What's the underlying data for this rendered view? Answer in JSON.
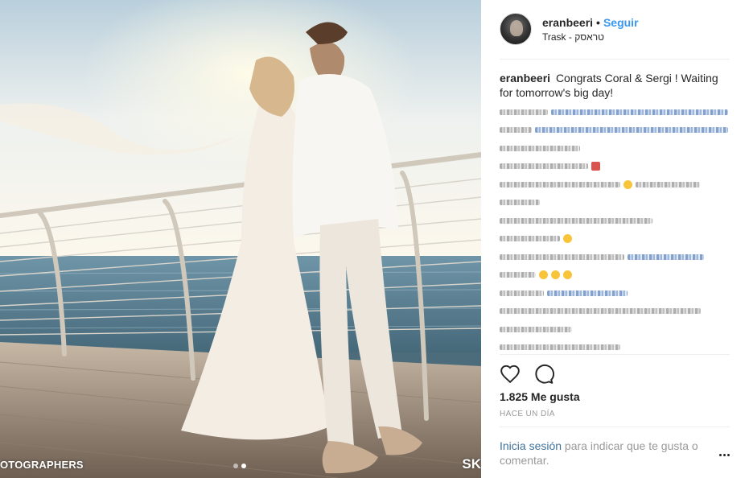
{
  "photo": {
    "watermark_left": "OTOGRAPHERS",
    "watermark_right": "SK",
    "carousel": {
      "count": 2,
      "active_index": 1
    }
  },
  "post": {
    "username": "eranbeeri",
    "separator": "•",
    "follow_label": "Seguir",
    "location": "Trask - טראסק",
    "caption_text": "Congrats Coral & Sergi ! Waiting for tomorrow's big day!",
    "likes": "1.825 Me gusta",
    "timestamp": "HACE UN DÍA",
    "login_link": "Inicia sesión",
    "login_rest": " para indicar que te gusta o comentar."
  },
  "icons": {
    "like": "heart-icon",
    "comment": "comment-icon",
    "more": "more-options-icon"
  },
  "colors": {
    "link_blue": "#3897f0",
    "text": "#262626",
    "muted": "#999999"
  }
}
